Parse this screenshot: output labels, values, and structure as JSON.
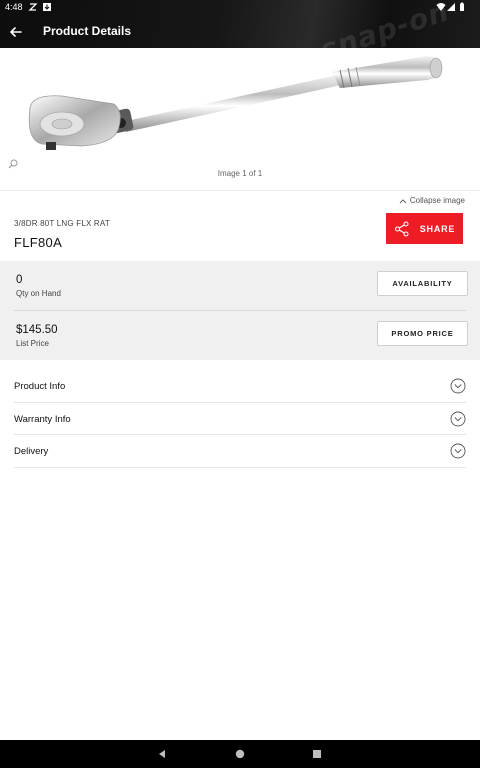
{
  "status_bar": {
    "time": "4:48"
  },
  "header": {
    "title": "Product Details",
    "brand_watermark": "snap-on"
  },
  "image": {
    "counter": "Image 1 of 1",
    "collapse_label": "Collapse image"
  },
  "product": {
    "description": "3/8DR 80T LNG FLX RAT",
    "code": "FLF80A",
    "share_label": "SHARE"
  },
  "info": {
    "qty_value": "0",
    "qty_label": "Qty on Hand",
    "availability_label": "AVAILABILITY",
    "price_value": "$145.50",
    "price_label": "List Price",
    "promo_label": "PROMO PRICE"
  },
  "accordion": {
    "items": [
      {
        "label": "Product Info"
      },
      {
        "label": "Warranty Info"
      },
      {
        "label": "Delivery"
      }
    ]
  },
  "colors": {
    "accent": "#ee1c25",
    "panel": "#f0f0f0"
  }
}
